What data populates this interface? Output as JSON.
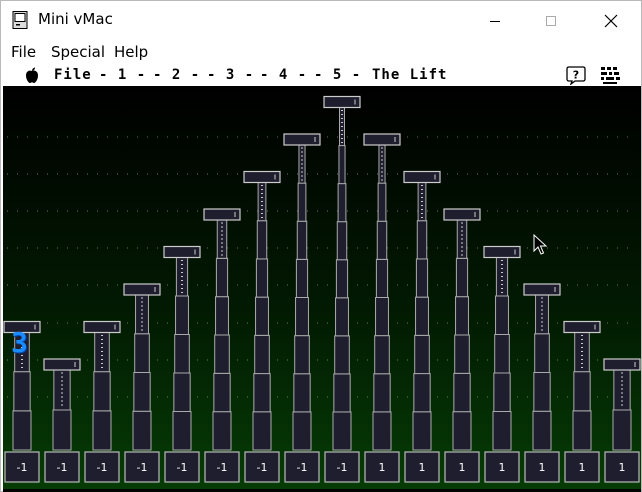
{
  "window": {
    "title": "Mini vMac",
    "buttons": {
      "minimize": "minimize",
      "maximize": "maximize",
      "close": "close"
    }
  },
  "host_menu": [
    "File",
    "Special",
    "Help"
  ],
  "mac_menu": {
    "apple": "apple-icon",
    "items": [
      "File",
      "- 1 -",
      "- 2 -",
      "- 3 -",
      "- 4 -",
      "- 5 -",
      "The Lift"
    ],
    "right_icons": [
      "help-icon",
      "keyboard-icon"
    ]
  },
  "game": {
    "floor_indicator": "3",
    "floor_indicator_color": "#1a8cff",
    "buttons": [
      "-1",
      "-1",
      "-1",
      "-1",
      "-1",
      "-1",
      "-1",
      "-1",
      "-1",
      "1",
      "1",
      "1",
      "1",
      "1",
      "1",
      "1"
    ],
    "column_levels": [
      1,
      0,
      1,
      2,
      3,
      4,
      5,
      6,
      7,
      6,
      5,
      4,
      3,
      2,
      1,
      0
    ]
  }
}
